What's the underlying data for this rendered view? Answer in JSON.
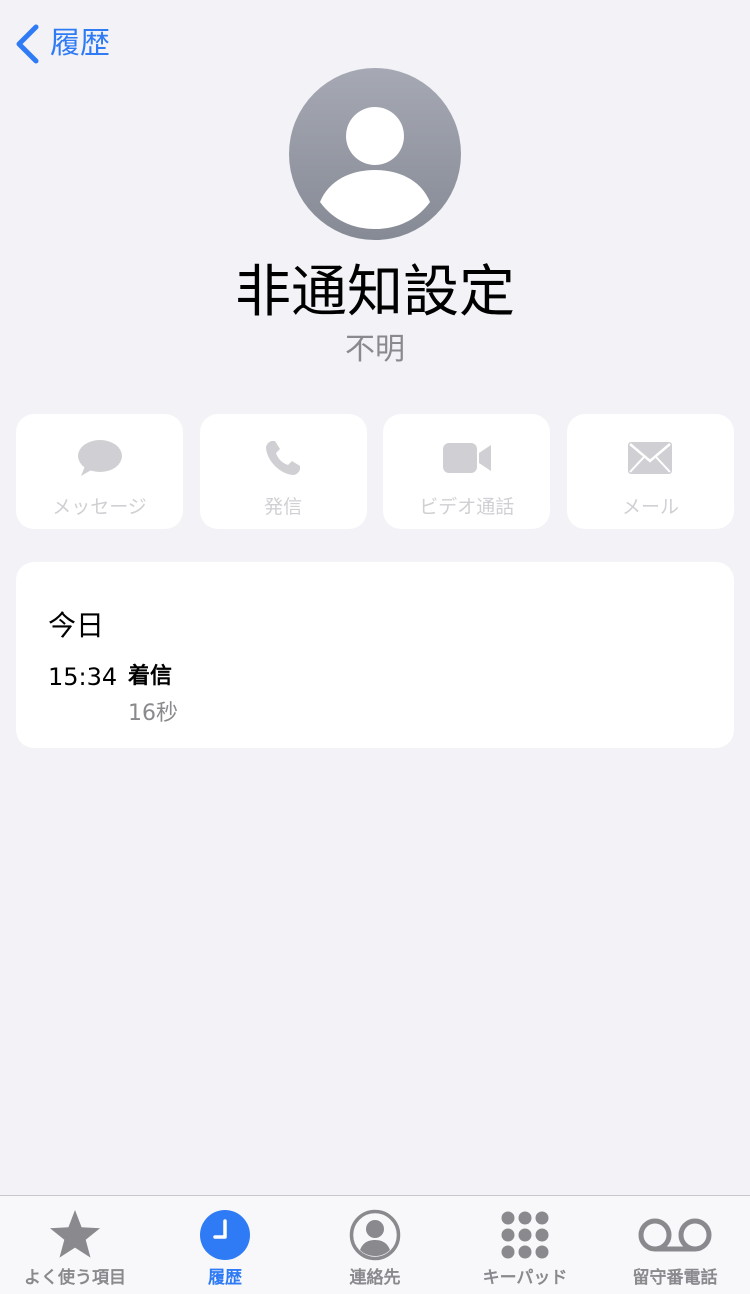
{
  "nav": {
    "back_label": "履歴"
  },
  "contact": {
    "name": "非通知設定",
    "subtitle": "不明"
  },
  "actions": [
    {
      "label": "メッセージ",
      "icon": "message-bubble-icon"
    },
    {
      "label": "発信",
      "icon": "phone-icon"
    },
    {
      "label": "ビデオ通話",
      "icon": "video-camera-icon"
    },
    {
      "label": "メール",
      "icon": "envelope-icon"
    }
  ],
  "history": {
    "date_heading": "今日",
    "entries": [
      {
        "time": "15:34",
        "type": "着信",
        "duration": "16秒"
      }
    ]
  },
  "tabbar": {
    "active": "履歴",
    "tabs": [
      {
        "label": "よく使う項目",
        "icon": "star-icon"
      },
      {
        "label": "履歴",
        "icon": "clock-icon"
      },
      {
        "label": "連絡先",
        "icon": "person-circle-icon"
      },
      {
        "label": "キーパッド",
        "icon": "keypad-icon"
      },
      {
        "label": "留守番電話",
        "icon": "voicemail-icon"
      }
    ]
  },
  "colors": {
    "accent": "#2f7bf5",
    "background": "#f2f2f7",
    "disabled": "#d0d0d4",
    "secondary_text": "#8a8a8e"
  }
}
